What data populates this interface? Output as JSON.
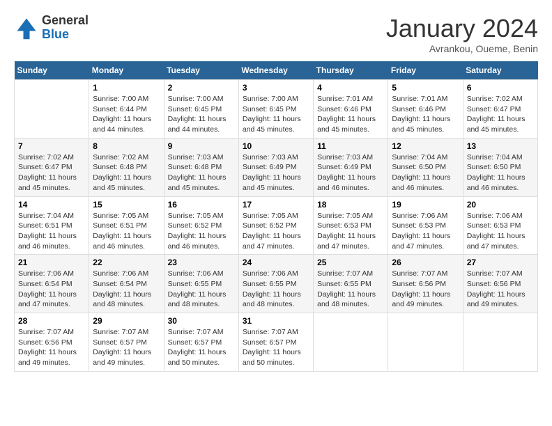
{
  "header": {
    "logo_general": "General",
    "logo_blue": "Blue",
    "title": "January 2024",
    "subtitle": "Avrankou, Oueme, Benin"
  },
  "days_of_week": [
    "Sunday",
    "Monday",
    "Tuesday",
    "Wednesday",
    "Thursday",
    "Friday",
    "Saturday"
  ],
  "weeks": [
    [
      {
        "day": "",
        "info": ""
      },
      {
        "day": "1",
        "info": "Sunrise: 7:00 AM\nSunset: 6:44 PM\nDaylight: 11 hours\nand 44 minutes."
      },
      {
        "day": "2",
        "info": "Sunrise: 7:00 AM\nSunset: 6:45 PM\nDaylight: 11 hours\nand 44 minutes."
      },
      {
        "day": "3",
        "info": "Sunrise: 7:00 AM\nSunset: 6:45 PM\nDaylight: 11 hours\nand 45 minutes."
      },
      {
        "day": "4",
        "info": "Sunrise: 7:01 AM\nSunset: 6:46 PM\nDaylight: 11 hours\nand 45 minutes."
      },
      {
        "day": "5",
        "info": "Sunrise: 7:01 AM\nSunset: 6:46 PM\nDaylight: 11 hours\nand 45 minutes."
      },
      {
        "day": "6",
        "info": "Sunrise: 7:02 AM\nSunset: 6:47 PM\nDaylight: 11 hours\nand 45 minutes."
      }
    ],
    [
      {
        "day": "7",
        "info": "Sunrise: 7:02 AM\nSunset: 6:47 PM\nDaylight: 11 hours\nand 45 minutes."
      },
      {
        "day": "8",
        "info": "Sunrise: 7:02 AM\nSunset: 6:48 PM\nDaylight: 11 hours\nand 45 minutes."
      },
      {
        "day": "9",
        "info": "Sunrise: 7:03 AM\nSunset: 6:48 PM\nDaylight: 11 hours\nand 45 minutes."
      },
      {
        "day": "10",
        "info": "Sunrise: 7:03 AM\nSunset: 6:49 PM\nDaylight: 11 hours\nand 45 minutes."
      },
      {
        "day": "11",
        "info": "Sunrise: 7:03 AM\nSunset: 6:49 PM\nDaylight: 11 hours\nand 46 minutes."
      },
      {
        "day": "12",
        "info": "Sunrise: 7:04 AM\nSunset: 6:50 PM\nDaylight: 11 hours\nand 46 minutes."
      },
      {
        "day": "13",
        "info": "Sunrise: 7:04 AM\nSunset: 6:50 PM\nDaylight: 11 hours\nand 46 minutes."
      }
    ],
    [
      {
        "day": "14",
        "info": "Sunrise: 7:04 AM\nSunset: 6:51 PM\nDaylight: 11 hours\nand 46 minutes."
      },
      {
        "day": "15",
        "info": "Sunrise: 7:05 AM\nSunset: 6:51 PM\nDaylight: 11 hours\nand 46 minutes."
      },
      {
        "day": "16",
        "info": "Sunrise: 7:05 AM\nSunset: 6:52 PM\nDaylight: 11 hours\nand 46 minutes."
      },
      {
        "day": "17",
        "info": "Sunrise: 7:05 AM\nSunset: 6:52 PM\nDaylight: 11 hours\nand 47 minutes."
      },
      {
        "day": "18",
        "info": "Sunrise: 7:05 AM\nSunset: 6:53 PM\nDaylight: 11 hours\nand 47 minutes."
      },
      {
        "day": "19",
        "info": "Sunrise: 7:06 AM\nSunset: 6:53 PM\nDaylight: 11 hours\nand 47 minutes."
      },
      {
        "day": "20",
        "info": "Sunrise: 7:06 AM\nSunset: 6:53 PM\nDaylight: 11 hours\nand 47 minutes."
      }
    ],
    [
      {
        "day": "21",
        "info": "Sunrise: 7:06 AM\nSunset: 6:54 PM\nDaylight: 11 hours\nand 47 minutes."
      },
      {
        "day": "22",
        "info": "Sunrise: 7:06 AM\nSunset: 6:54 PM\nDaylight: 11 hours\nand 48 minutes."
      },
      {
        "day": "23",
        "info": "Sunrise: 7:06 AM\nSunset: 6:55 PM\nDaylight: 11 hours\nand 48 minutes."
      },
      {
        "day": "24",
        "info": "Sunrise: 7:06 AM\nSunset: 6:55 PM\nDaylight: 11 hours\nand 48 minutes."
      },
      {
        "day": "25",
        "info": "Sunrise: 7:07 AM\nSunset: 6:55 PM\nDaylight: 11 hours\nand 48 minutes."
      },
      {
        "day": "26",
        "info": "Sunrise: 7:07 AM\nSunset: 6:56 PM\nDaylight: 11 hours\nand 49 minutes."
      },
      {
        "day": "27",
        "info": "Sunrise: 7:07 AM\nSunset: 6:56 PM\nDaylight: 11 hours\nand 49 minutes."
      }
    ],
    [
      {
        "day": "28",
        "info": "Sunrise: 7:07 AM\nSunset: 6:56 PM\nDaylight: 11 hours\nand 49 minutes."
      },
      {
        "day": "29",
        "info": "Sunrise: 7:07 AM\nSunset: 6:57 PM\nDaylight: 11 hours\nand 49 minutes."
      },
      {
        "day": "30",
        "info": "Sunrise: 7:07 AM\nSunset: 6:57 PM\nDaylight: 11 hours\nand 50 minutes."
      },
      {
        "day": "31",
        "info": "Sunrise: 7:07 AM\nSunset: 6:57 PM\nDaylight: 11 hours\nand 50 minutes."
      },
      {
        "day": "",
        "info": ""
      },
      {
        "day": "",
        "info": ""
      },
      {
        "day": "",
        "info": ""
      }
    ]
  ]
}
